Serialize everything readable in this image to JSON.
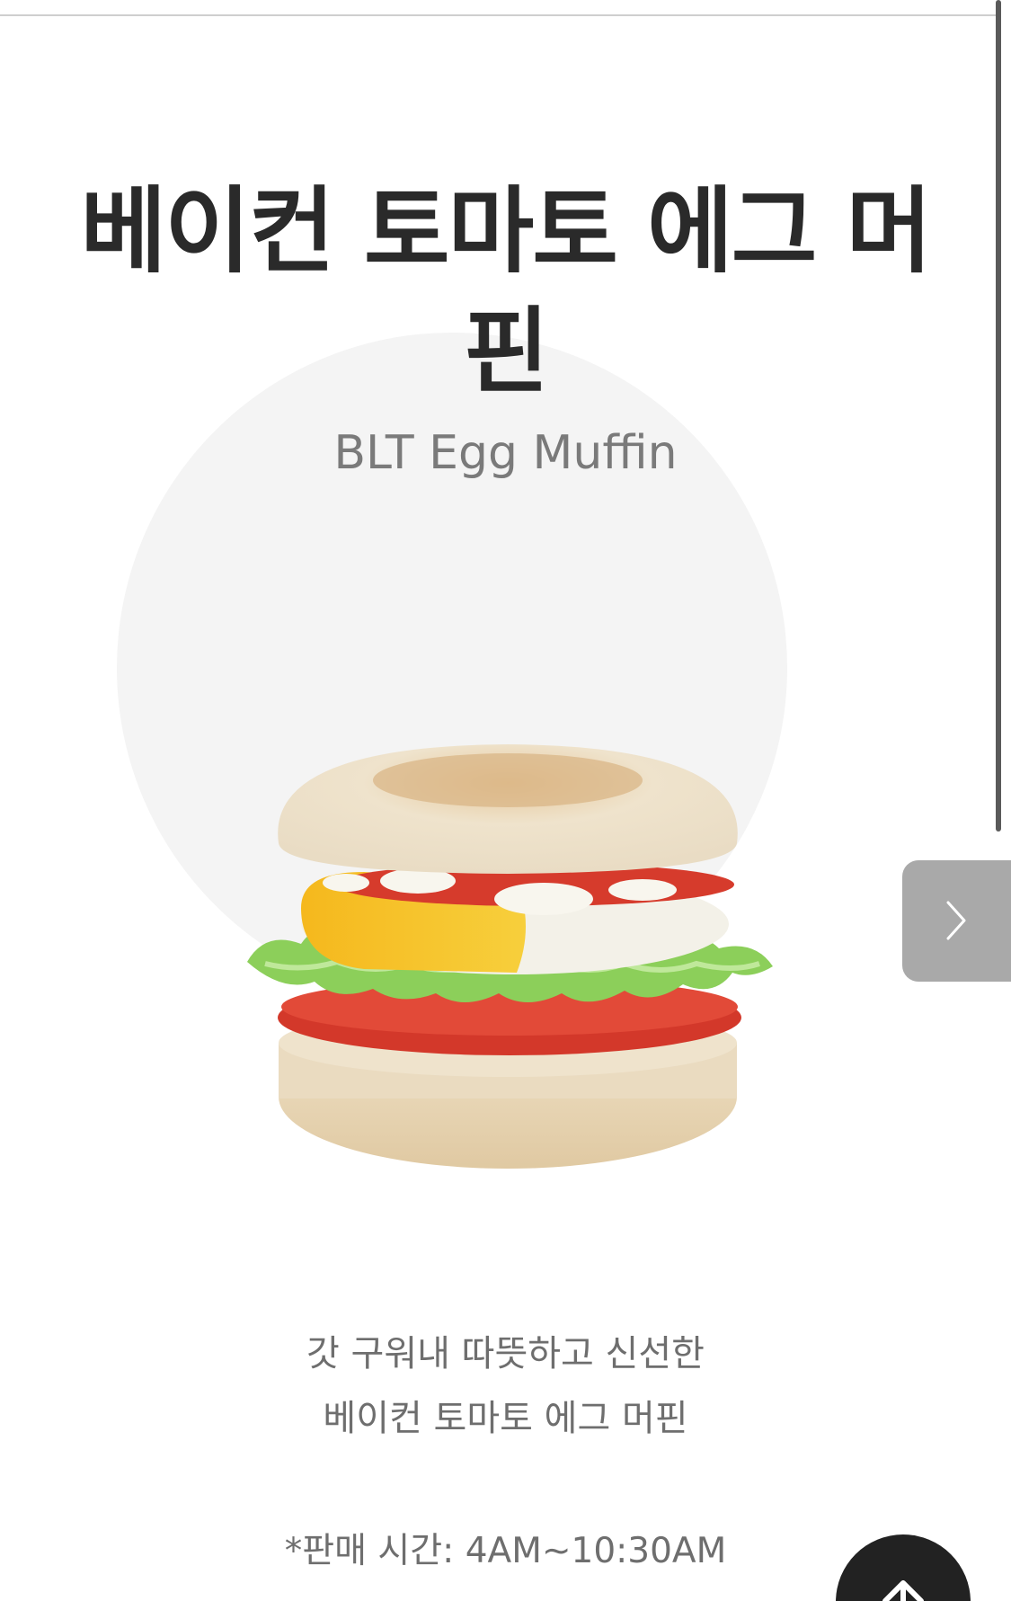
{
  "product": {
    "name_ko": "베이컨 토마토 에그 머핀",
    "name_en": "BLT Egg Muffin",
    "description_lines": [
      "갓 구워내 따뜻하고 신선한",
      "베이컨 토마토 에그 머핀"
    ],
    "sale_time": "*판매 시간: 4AM~10:30AM"
  },
  "controls": {
    "next_icon": "chevron-right-icon",
    "scroll_top_icon": "arrow-up-icon"
  },
  "colors": {
    "next_button_bg": "#a9a9a9",
    "scroll_top_bg": "#222222",
    "circle_bg": "#f4f4f4"
  }
}
